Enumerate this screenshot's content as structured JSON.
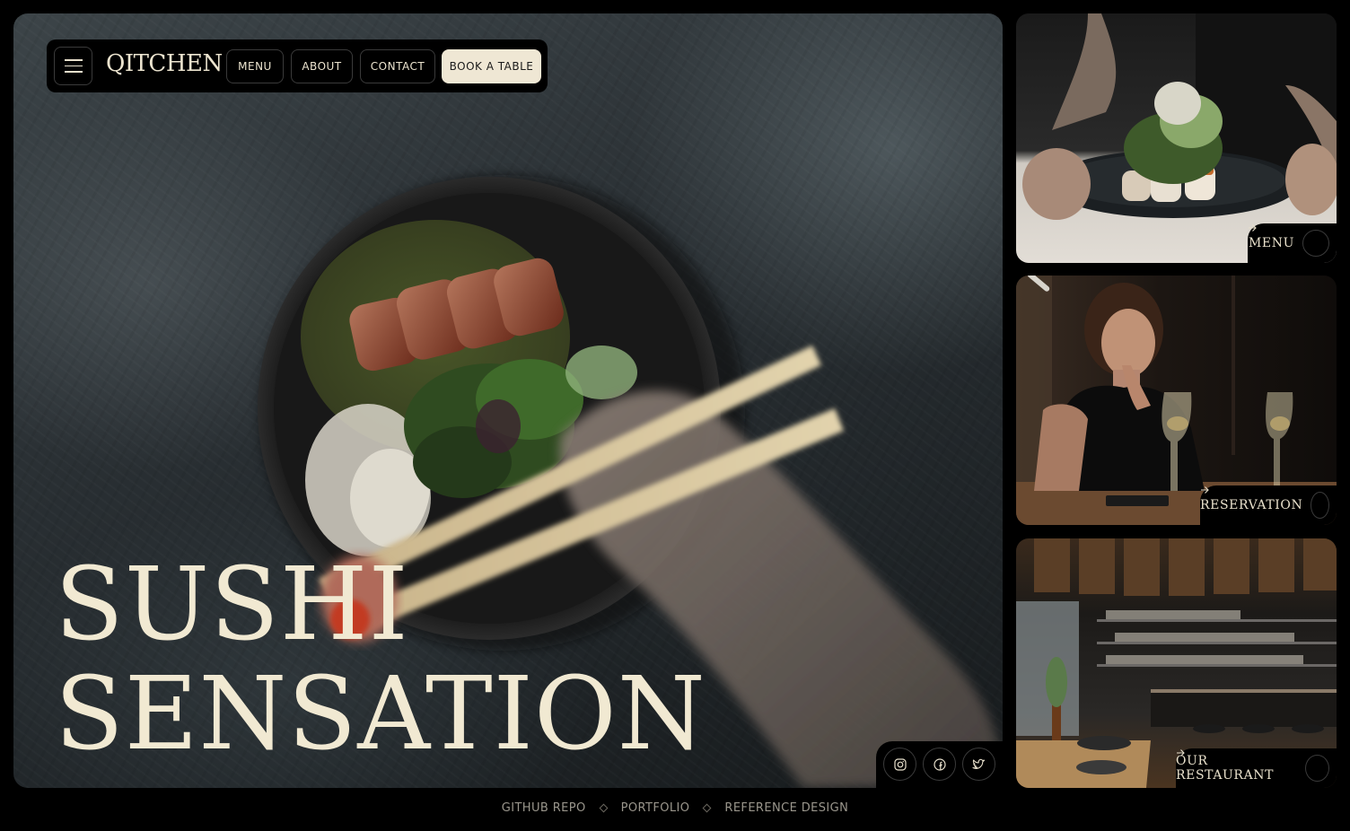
{
  "brand": {
    "logo": "QITCHEN"
  },
  "nav": {
    "menu_label": "MENU",
    "about_label": "ABOUT",
    "contact_label": "CONTACT",
    "book_label": "BOOK A TABLE"
  },
  "hero": {
    "title_line1": "SUSHI",
    "title_line2": "SENSATION"
  },
  "social": {
    "icons": [
      "instagram-icon",
      "facebook-icon",
      "twitter-icon"
    ]
  },
  "cards": [
    {
      "label": "MENU"
    },
    {
      "label": "RESERVATION"
    },
    {
      "label": "OUR RESTAURANT"
    }
  ],
  "footer": {
    "github": "GITHUB REPO",
    "portfolio": "PORTFOLIO",
    "reference": "REFERENCE DESIGN"
  },
  "colors": {
    "background": "#000000",
    "cream": "#efe7d4",
    "border": "#3a3a3a"
  }
}
